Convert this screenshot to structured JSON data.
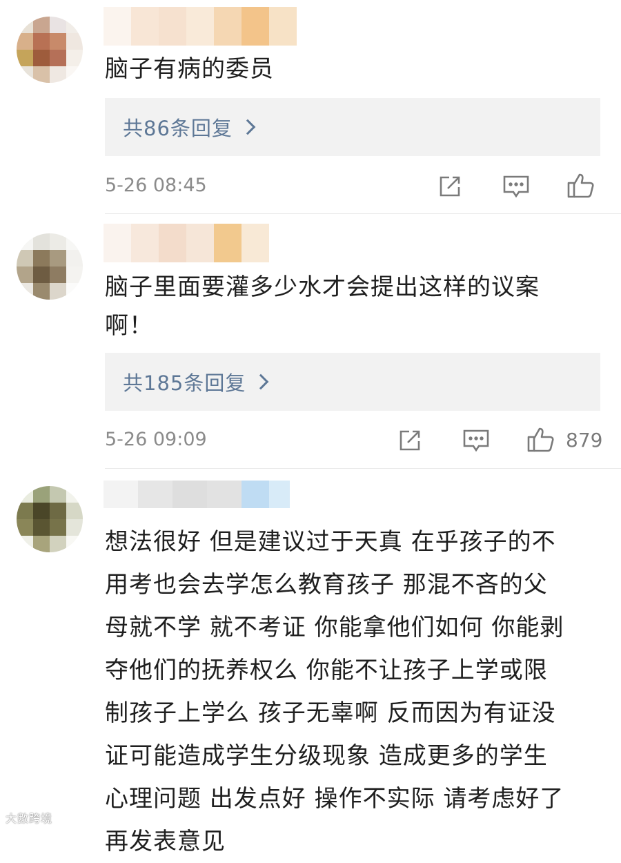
{
  "comments": [
    {
      "text_lines": [
        "脑子有病的委员"
      ],
      "reply_label": "共86条回复",
      "time": "5-26 08:45",
      "likes": ""
    },
    {
      "text_lines": [
        "脑子里面要灌多少水才会提出这样的议案",
        "啊！"
      ],
      "reply_label": "共185条回复",
      "time": "5-26 09:09",
      "likes": "879"
    },
    {
      "text_lines": [
        "想法很好 但是建议过于天真 在乎孩子的不",
        "用考也会去学怎么教育孩子 那混不吝的父",
        "母就不学 就不考证 你能拿他们如何 你能剥",
        "夺他们的抚养权么 你能不让孩子上学或限",
        "制孩子上学么 孩子无辜啊 反而因为有证没",
        "证可能造成学生分级现象 造成更多的学生",
        "心理问题 出发点好 操作不实际 请考虑好了",
        "再发表意见"
      ]
    }
  ],
  "icons": {
    "share": "share-icon",
    "comment": "comment-icon",
    "like": "thumbs-up-icon"
  },
  "colors": {
    "reply_link": "#5d7796",
    "reply_bg": "#f2f2f2",
    "meta_text": "#8b8b8b"
  },
  "watermark": "大數跨境"
}
